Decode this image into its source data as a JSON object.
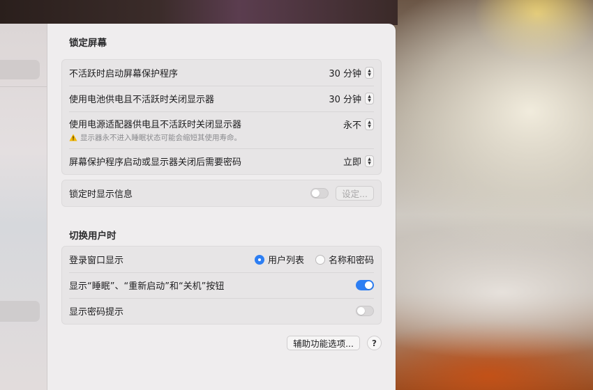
{
  "lock_screen": {
    "title": "锁定屏幕",
    "rows": [
      {
        "label": "不活跃时启动屏幕保护程序",
        "value": "30 分钟"
      },
      {
        "label": "使用电池供电且不活跃时关闭显示器",
        "value": "30 分钟"
      },
      {
        "label": "使用电源适配器供电且不活跃时关闭显示器",
        "value": "永不",
        "warning": "显示器永不进入睡眠状态可能会缩短其使用寿命。"
      },
      {
        "label": "屏幕保护程序启动或显示器关闭后需要密码",
        "value": "立即"
      }
    ],
    "show_message": {
      "label": "锁定时显示信息",
      "enabled": false,
      "button": "设定..."
    }
  },
  "switch_user": {
    "title": "切换用户时",
    "login_window": {
      "label": "登录窗口显示",
      "options": [
        "用户列表",
        "名称和密码"
      ],
      "selected": "用户列表"
    },
    "show_buttons": {
      "label": "显示“睡眠”、“重新启动”和“关机”按钮",
      "enabled": true
    },
    "show_hint": {
      "label": "显示密码提示",
      "enabled": false
    }
  },
  "footer": {
    "accessibility_button": "辅助功能选项...",
    "help_label": "?"
  },
  "colors": {
    "accent": "#2d7ef3",
    "warning": "#f2b705"
  },
  "icons": {
    "warning": "warning-triangle-icon",
    "stepper": "up-down-chevron-icon"
  }
}
